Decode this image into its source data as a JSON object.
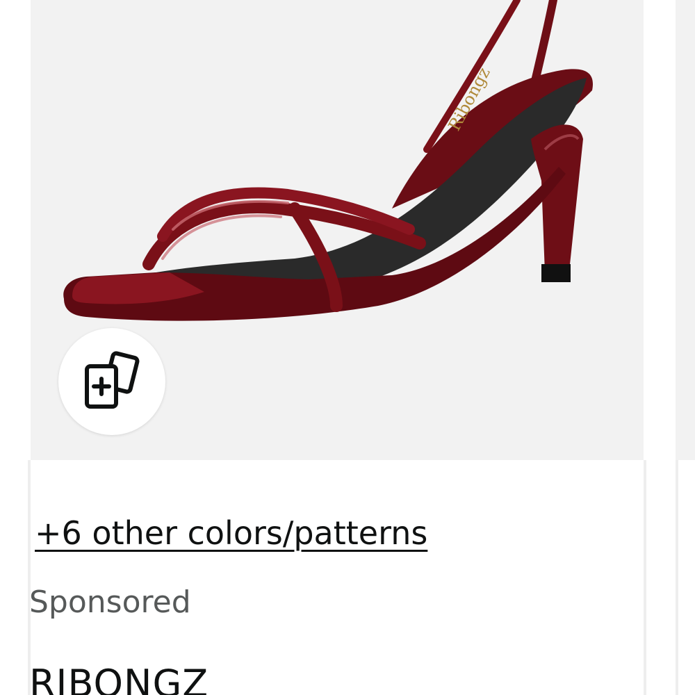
{
  "product_card": {
    "image_alt": "dark red patent strappy heeled sandal",
    "shoe_insole_logo": "Ribongz",
    "similar_items_icon": "compare-cards-icon",
    "colors_link": "+6 other colors/patterns",
    "sponsored_label": "Sponsored",
    "brand_name": "RIBONGZ"
  },
  "colors": {
    "image_background": "#f2f2f2",
    "shoe_red": "#7a1018",
    "link_text": "#0f1111",
    "sponsored_text": "#565959"
  }
}
